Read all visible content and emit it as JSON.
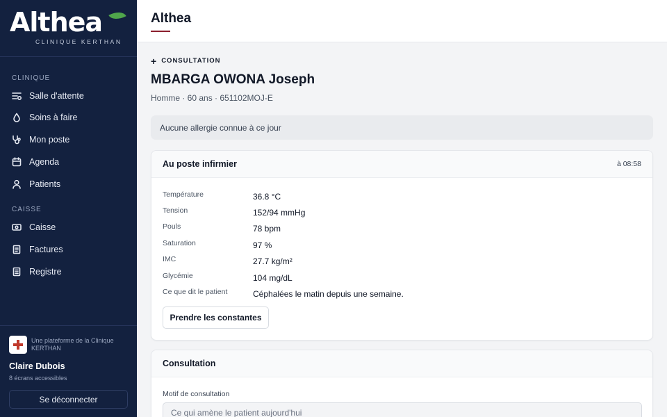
{
  "brand": {
    "name": "Althea",
    "subtitle": "CLINIQUE KERTHAN"
  },
  "sidebar": {
    "sections": [
      {
        "label": "CLINIQUE",
        "items": [
          {
            "label": "Salle d'attente",
            "icon": "waiting-list-icon"
          },
          {
            "label": "Soins à faire",
            "icon": "droplet-icon"
          },
          {
            "label": "Mon poste",
            "icon": "stethoscope-icon"
          },
          {
            "label": "Agenda",
            "icon": "calendar-icon"
          },
          {
            "label": "Patients",
            "icon": "user-icon"
          }
        ]
      },
      {
        "label": "CAISSE",
        "items": [
          {
            "label": "Caisse",
            "icon": "cash-icon"
          },
          {
            "label": "Factures",
            "icon": "document-icon"
          },
          {
            "label": "Registre",
            "icon": "register-icon"
          }
        ]
      }
    ],
    "footer": {
      "platform_text": "Une plateforme de la Clinique KERTHAN",
      "user_name": "Claire Dubois",
      "screens_text": "8 écrans accessibles",
      "logout_label": "Se déconnecter"
    }
  },
  "header": {
    "title": "Althea",
    "accent_color": "#8b1e2d"
  },
  "page": {
    "eyebrow": "CONSULTATION",
    "patient_name": "MBARGA OWONA Joseph",
    "patient_meta": "Homme · 60 ans · 651102MOJ-E",
    "allergy_text": "Aucune allergie connue à ce jour"
  },
  "nurse_card": {
    "title": "Au poste infirmier",
    "time": "à 08:58",
    "vitals": [
      {
        "label": "Température",
        "value": "36.8 °C"
      },
      {
        "label": "Tension",
        "value": "152/94 mmHg"
      },
      {
        "label": "Pouls",
        "value": "78 bpm"
      },
      {
        "label": "Saturation",
        "value": "97 %"
      },
      {
        "label": "IMC",
        "value": "27.7 kg/m²"
      },
      {
        "label": "Glycémie",
        "value": "104 mg/dL"
      },
      {
        "label": "Ce que dit le patient",
        "value": "Céphalées le matin depuis une semaine."
      }
    ],
    "button_label": "Prendre les constantes"
  },
  "consultation_card": {
    "title": "Consultation",
    "field_label": "Motif de consultation",
    "field_placeholder": "Ce qui amène le patient aujourd'hui",
    "field_value": ""
  },
  "colors": {
    "sidebar_bg": "#13213f",
    "leaf_green": "#4fa64b",
    "clinic_red": "#c0392b"
  }
}
